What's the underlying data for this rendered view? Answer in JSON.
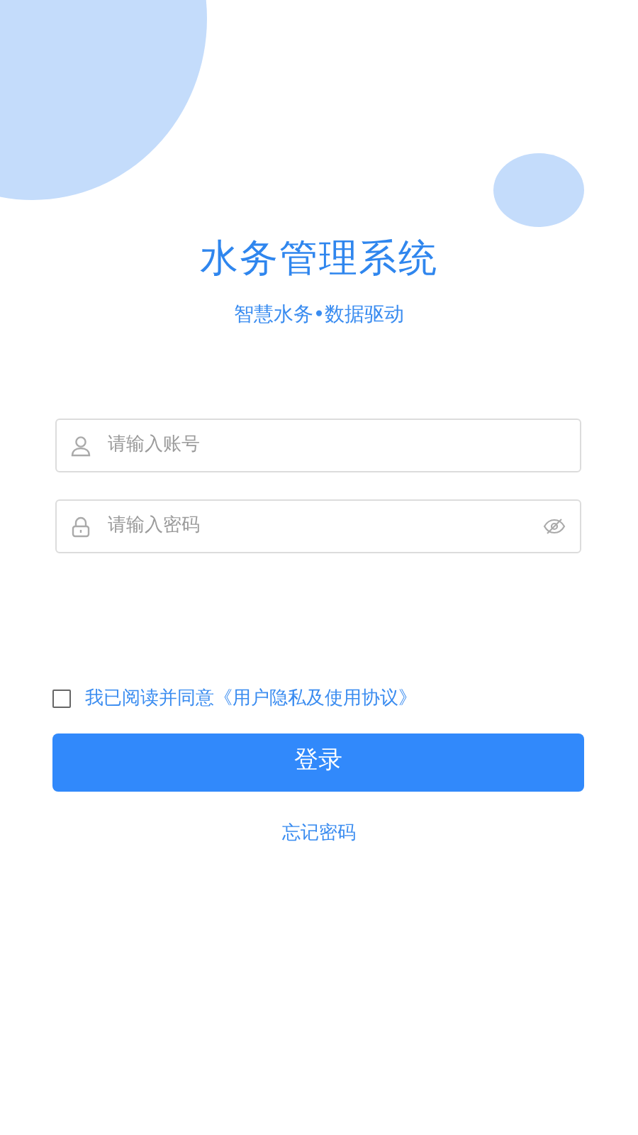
{
  "title": "水务管理系统",
  "subtitle": "智慧水务•数据驱动",
  "fields": [
    {
      "kind": "account",
      "placeholder": "请输入账号"
    },
    {
      "kind": "password",
      "placeholder": "请输入密码"
    }
  ],
  "agreement": {
    "checked": false,
    "text": "我已阅读并同意《用户隐私及使用协议》"
  },
  "login_button": "登录",
  "forgot_link": "忘记密码"
}
